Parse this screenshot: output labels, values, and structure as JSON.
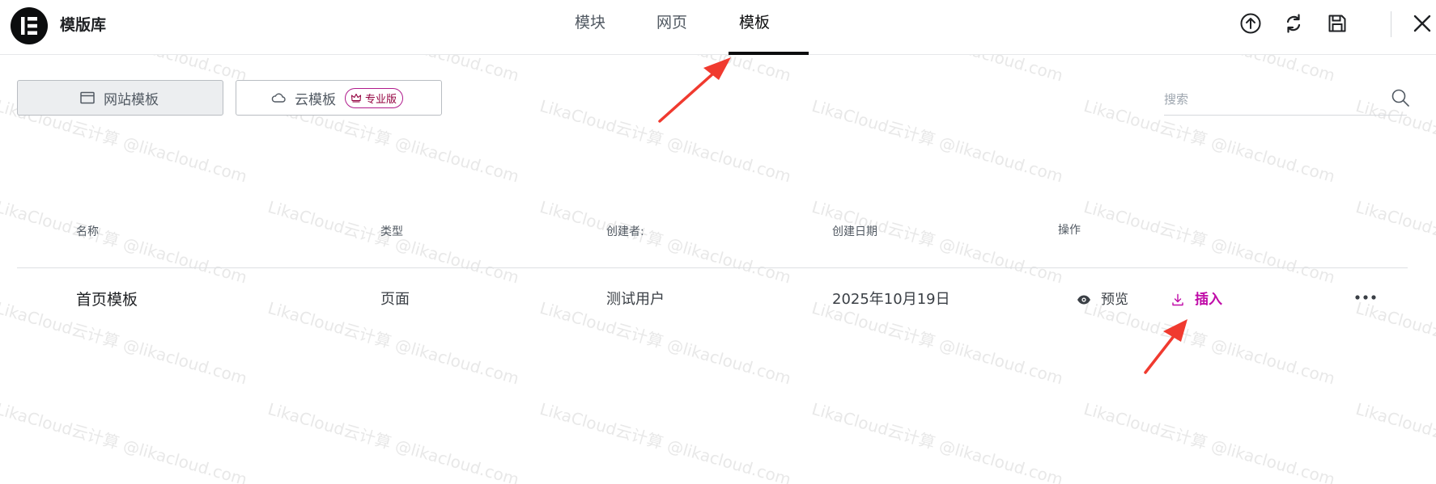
{
  "header": {
    "title": "模版库",
    "tabs": [
      {
        "label": "模块",
        "active": false
      },
      {
        "label": "网页",
        "active": false
      },
      {
        "label": "模板",
        "active": true
      }
    ],
    "icons": [
      "upload-icon",
      "sync-icon",
      "save-icon",
      "close-icon"
    ]
  },
  "sources": {
    "site_label": "网站模板",
    "cloud_label": "云模板",
    "pro_badge": "专业版"
  },
  "search": {
    "placeholder": "搜索",
    "value": ""
  },
  "table": {
    "headers": [
      "名称",
      "类型",
      "创建者:",
      "创建日期",
      "操作"
    ],
    "rows": [
      {
        "name": "首页模板",
        "type": "页面",
        "author": "测试用户",
        "date": "2025年10月19日",
        "preview_label": "预览",
        "insert_label": "插入"
      }
    ]
  },
  "watermark": "LikaCloud云计算 @likacloud.com",
  "colors": {
    "accent": "#c00ca8",
    "badge_border": "#b01b8c",
    "annotation_arrow": "#f03a2f",
    "active_tab": "#0c0d0e"
  }
}
